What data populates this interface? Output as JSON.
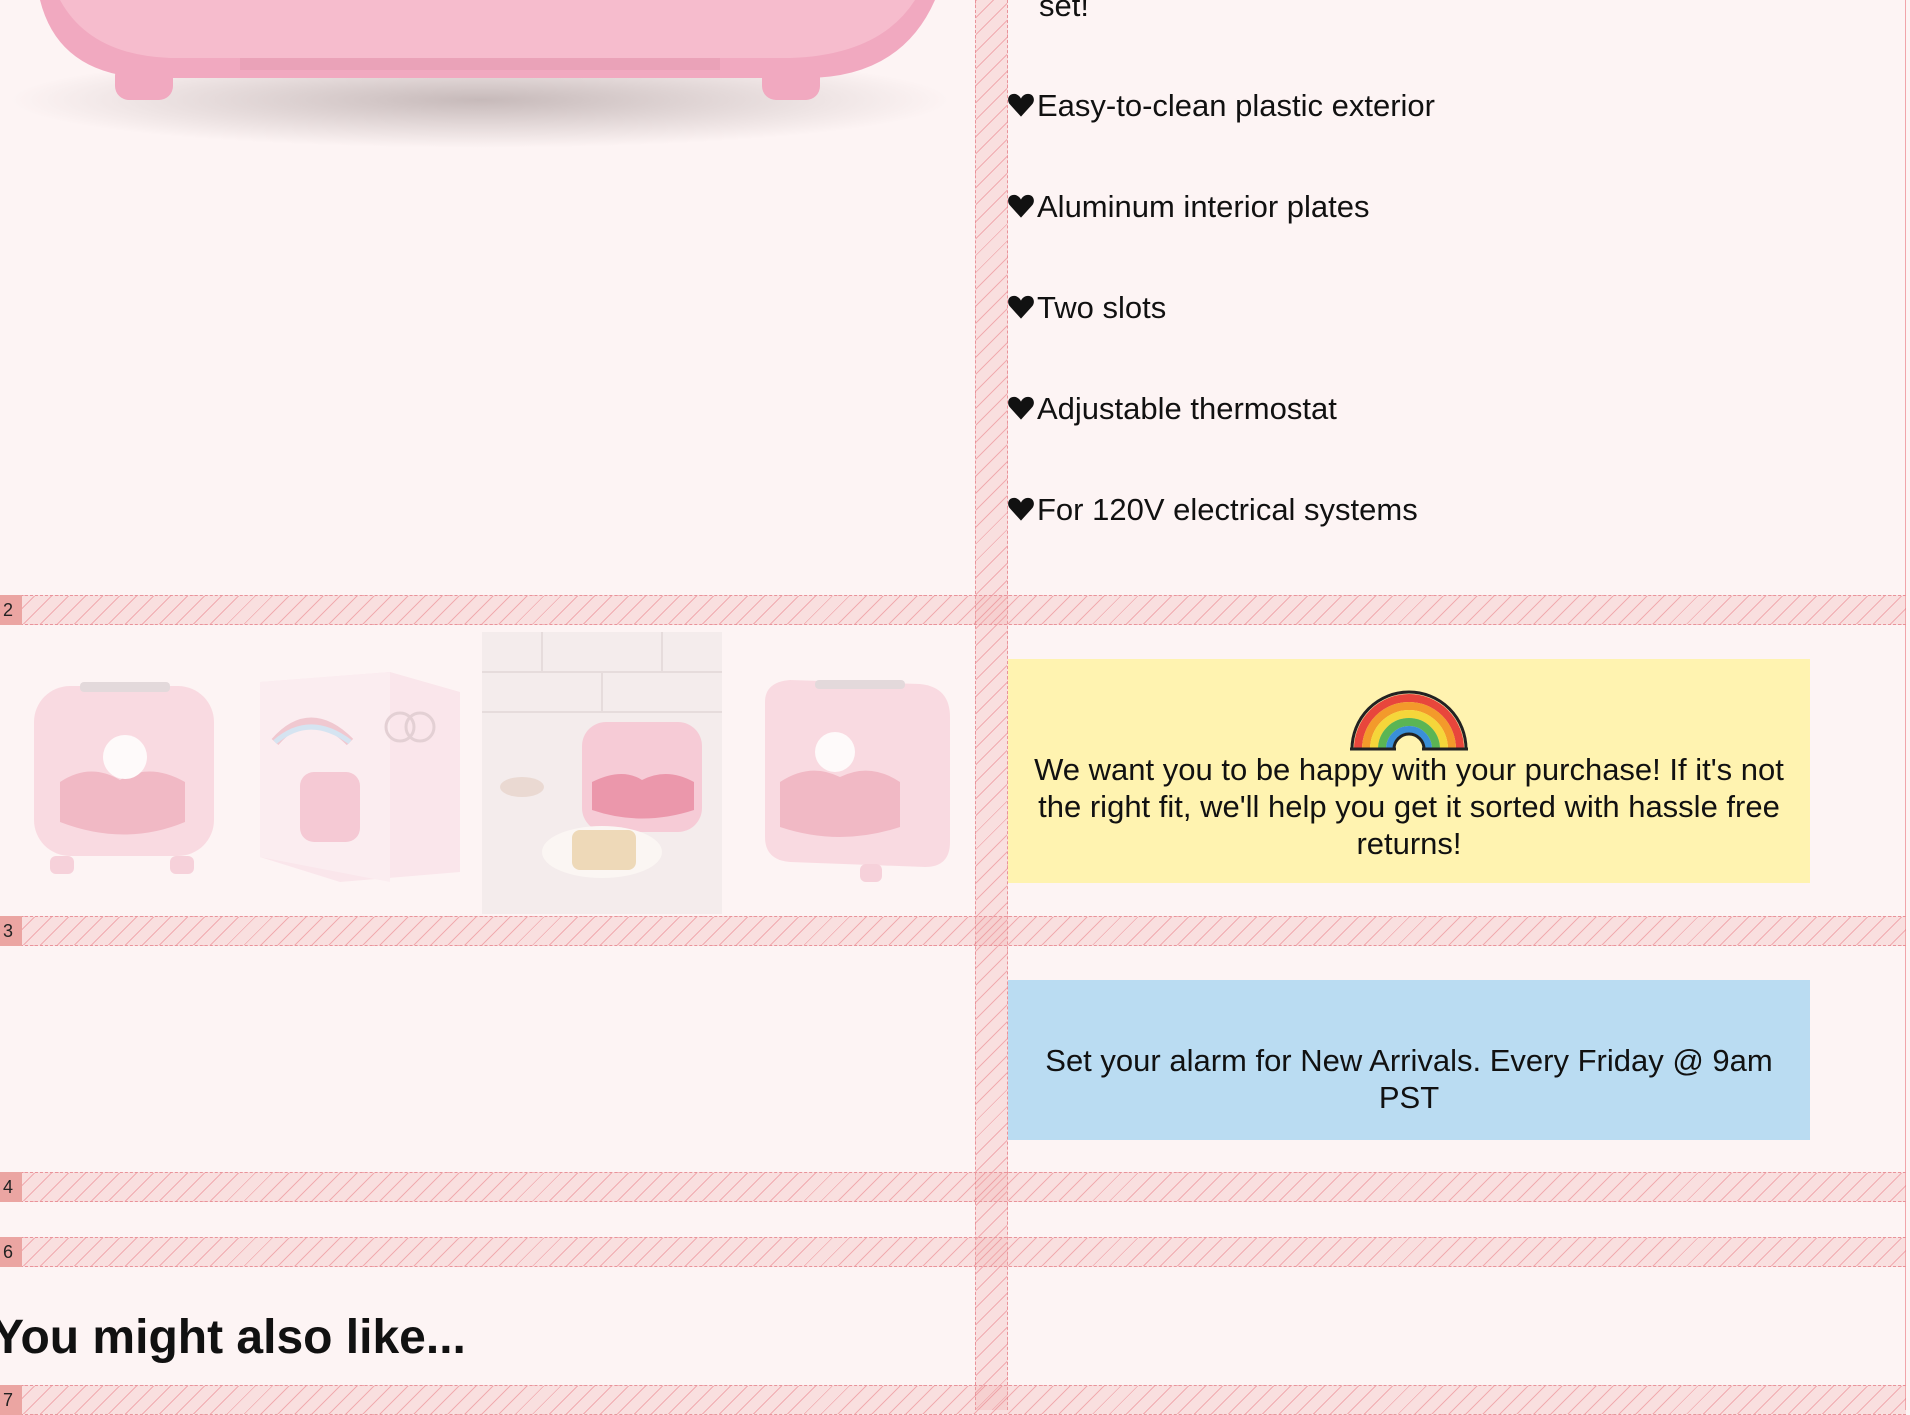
{
  "features": {
    "top_fragment": "set!",
    "items": [
      "Easy-to-clean plastic exterior",
      "Aluminum interior plates",
      "Two slots",
      "Adjustable thermostat",
      "For 120V electrical systems"
    ]
  },
  "row_labels": [
    "2",
    "3",
    "4",
    "6",
    "7"
  ],
  "returns_card": {
    "text": "We want you to be happy with your purchase! If it's not the right fit, we'll help you get it sorted with hassle free returns!",
    "icon": "rainbow-icon",
    "bg_color": "#fff3b0"
  },
  "alarm_card": {
    "text": "Set your alarm for New Arrivals. Every Friday @ 9am PST",
    "bg_color": "#badcf2"
  },
  "thumbnails": [
    {
      "alt": "pink-toaster-front"
    },
    {
      "alt": "toaster-box"
    },
    {
      "alt": "toaster-kitchen-scene"
    },
    {
      "alt": "pink-toaster-angle"
    }
  ],
  "related": {
    "title": "You might also like..."
  },
  "colors": {
    "page_bg": "#fdf4f4",
    "grid_stripe": "#e9939a",
    "label_bg": "#eba5a2"
  }
}
